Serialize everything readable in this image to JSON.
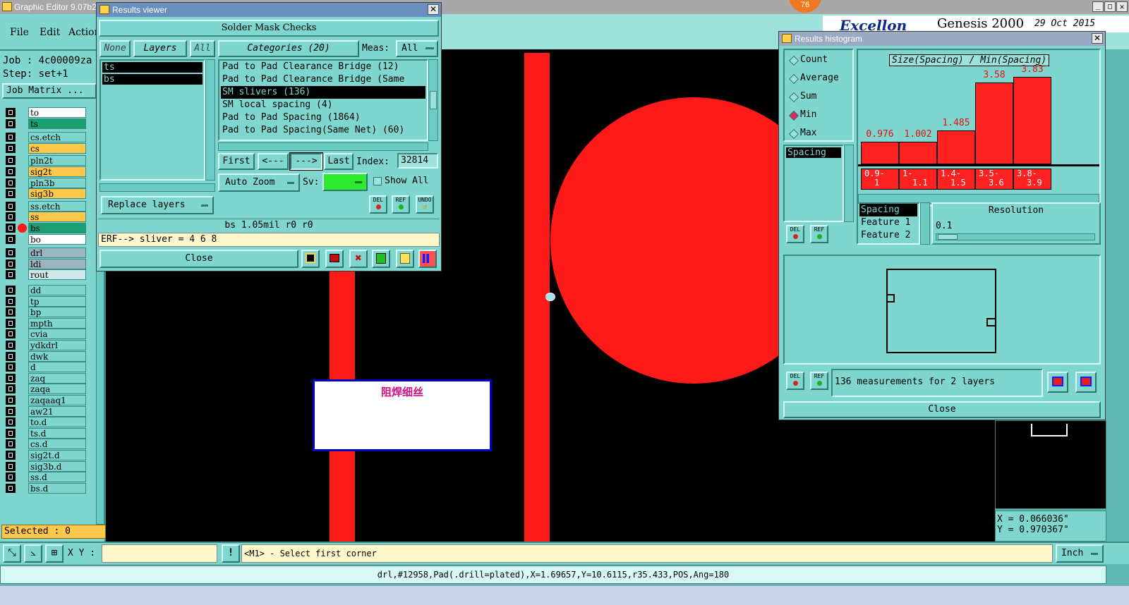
{
  "app": {
    "title": "Graphic Editor 9.07b2"
  },
  "menu": {
    "file": "File",
    "edit": "Edit",
    "action": "Action"
  },
  "job": {
    "label": "Job : 4c00009za",
    "step": "Step: set+1",
    "matrix_button": "Job Matrix ..."
  },
  "brand": {
    "name": "Genesis 2000",
    "date": "29 Oct 2015",
    "badge": "76"
  },
  "layers": [
    {
      "name": "to",
      "color": "#ffffff"
    },
    {
      "name": "ts",
      "color": "#1a9f73"
    },
    {
      "name": "cs.etch",
      "color": "#7fd6ce"
    },
    {
      "name": "cs",
      "color": "#ffc84a"
    },
    {
      "name": "pln2t",
      "color": "#7fd6ce"
    },
    {
      "name": "sig2t",
      "color": "#ffc84a"
    },
    {
      "name": "pln3b",
      "color": "#7fd6ce"
    },
    {
      "name": "sig3b",
      "color": "#ffc84a"
    },
    {
      "name": "ss.etch",
      "color": "#7fd6ce"
    },
    {
      "name": "ss",
      "color": "#ffc84a"
    },
    {
      "name": "bs",
      "color": "#1a9f73"
    },
    {
      "name": "bo",
      "color": "#ffffff"
    },
    {
      "name": "drl",
      "color": "#9ab4c0"
    },
    {
      "name": "ldi",
      "color": "#9ab4c0"
    },
    {
      "name": "rout",
      "color": "#cfe8ea"
    },
    {
      "name": "dd",
      "color": "#7fd6ce"
    },
    {
      "name": "tp",
      "color": "#7fd6ce"
    },
    {
      "name": "bp",
      "color": "#7fd6ce"
    },
    {
      "name": "mpth",
      "color": "#7fd6ce"
    },
    {
      "name": "cvia",
      "color": "#7fd6ce"
    },
    {
      "name": "ydkdrl",
      "color": "#7fd6ce"
    },
    {
      "name": "dwk",
      "color": "#7fd6ce"
    },
    {
      "name": "d",
      "color": "#7fd6ce"
    },
    {
      "name": "zaq",
      "color": "#7fd6ce"
    },
    {
      "name": "zaqa",
      "color": "#7fd6ce"
    },
    {
      "name": "zaqaaq1",
      "color": "#7fd6ce"
    },
    {
      "name": "aw21",
      "color": "#7fd6ce"
    },
    {
      "name": "to.d",
      "color": "#7fd6ce"
    },
    {
      "name": "ts.d",
      "color": "#7fd6ce"
    },
    {
      "name": "cs.d",
      "color": "#7fd6ce"
    },
    {
      "name": "sig2t.d",
      "color": "#7fd6ce"
    },
    {
      "name": "sig3b.d",
      "color": "#7fd6ce"
    },
    {
      "name": "ss.d",
      "color": "#7fd6ce"
    },
    {
      "name": "bs.d",
      "color": "#7fd6ce"
    }
  ],
  "selected": "Selected : 0",
  "results_viewer": {
    "title": "Results viewer",
    "header": "Solder Mask Checks",
    "none_btn": "None",
    "layers_btn": "Layers",
    "all_btn": "All",
    "categories_btn": "Categories (20)",
    "meas_label": "Meas:",
    "meas_value": "All",
    "layer_list": [
      "ts",
      "bs"
    ],
    "categories": [
      "Pad to Pad Clearance Bridge (12)",
      "Pad to Pad Clearance Bridge (Same",
      "SM slivers (136)",
      "SM local spacing (4)",
      "Pad to Pad Spacing (1864)",
      "Pad to Pad Spacing(Same Net) (60)"
    ],
    "first_btn": "First",
    "prev_btn": "<---",
    "next_btn": "--->",
    "last_btn": "Last",
    "index_label": "Index:",
    "index_value": "32814",
    "auto_zoom": "Auto Zoom",
    "sv_label": "Sv:",
    "show_all": "Show All",
    "replace_layers": "Replace layers",
    "del": "DEL",
    "ref": "REF",
    "undo": "UNDO",
    "status": "bs 1.05mil  r0  r0",
    "erf": "ERF--> sliver = 4 6 8",
    "close": "Close"
  },
  "histogram": {
    "title": "Results histogram",
    "count": "Count",
    "average": "Average",
    "sum": "Sum",
    "min": "Min",
    "max": "Max",
    "chart_title": "Size(Spacing) / Min(Spacing)",
    "bar_values": [
      0.976,
      1.002,
      1.485,
      3.58,
      3.83
    ],
    "bar_labels": [
      "0.976",
      "1.002",
      "1.485",
      "3.58",
      "3.83"
    ],
    "bin_labels_1": [
      "0.9-",
      "1-",
      "1.4-",
      "3.5-",
      "3.8-"
    ],
    "bin_labels_2": [
      "1",
      "1.1",
      "1.5",
      "3.6",
      "3.9"
    ],
    "attr_list": [
      "Spacing"
    ],
    "feature_list": [
      "Spacing",
      "Feature 1",
      "Feature 2"
    ],
    "resolution_label": "Resolution",
    "resolution_value": "0.1",
    "del": "DEL",
    "ref": "REF",
    "measurements": "136 measurements for 2 layers",
    "close": "Close"
  },
  "canvas": {
    "annotation": "阻焊细丝"
  },
  "coords": {
    "x": "X = 0.066036\"",
    "y": "Y = 0.970367\""
  },
  "bottom": {
    "xy_label": "X Y :",
    "xy_value": "",
    "prompt": "<M1> - Select first corner",
    "units": "Inch",
    "status": "drl,#12958,Pad(.drill=plated),X=1.69657,Y=10.6115,r35.433,POS,Ang=180"
  },
  "colors": {
    "teal": "#7fd6ce",
    "red": "#ff1a1a",
    "titlebar": "#6a8fbf"
  }
}
